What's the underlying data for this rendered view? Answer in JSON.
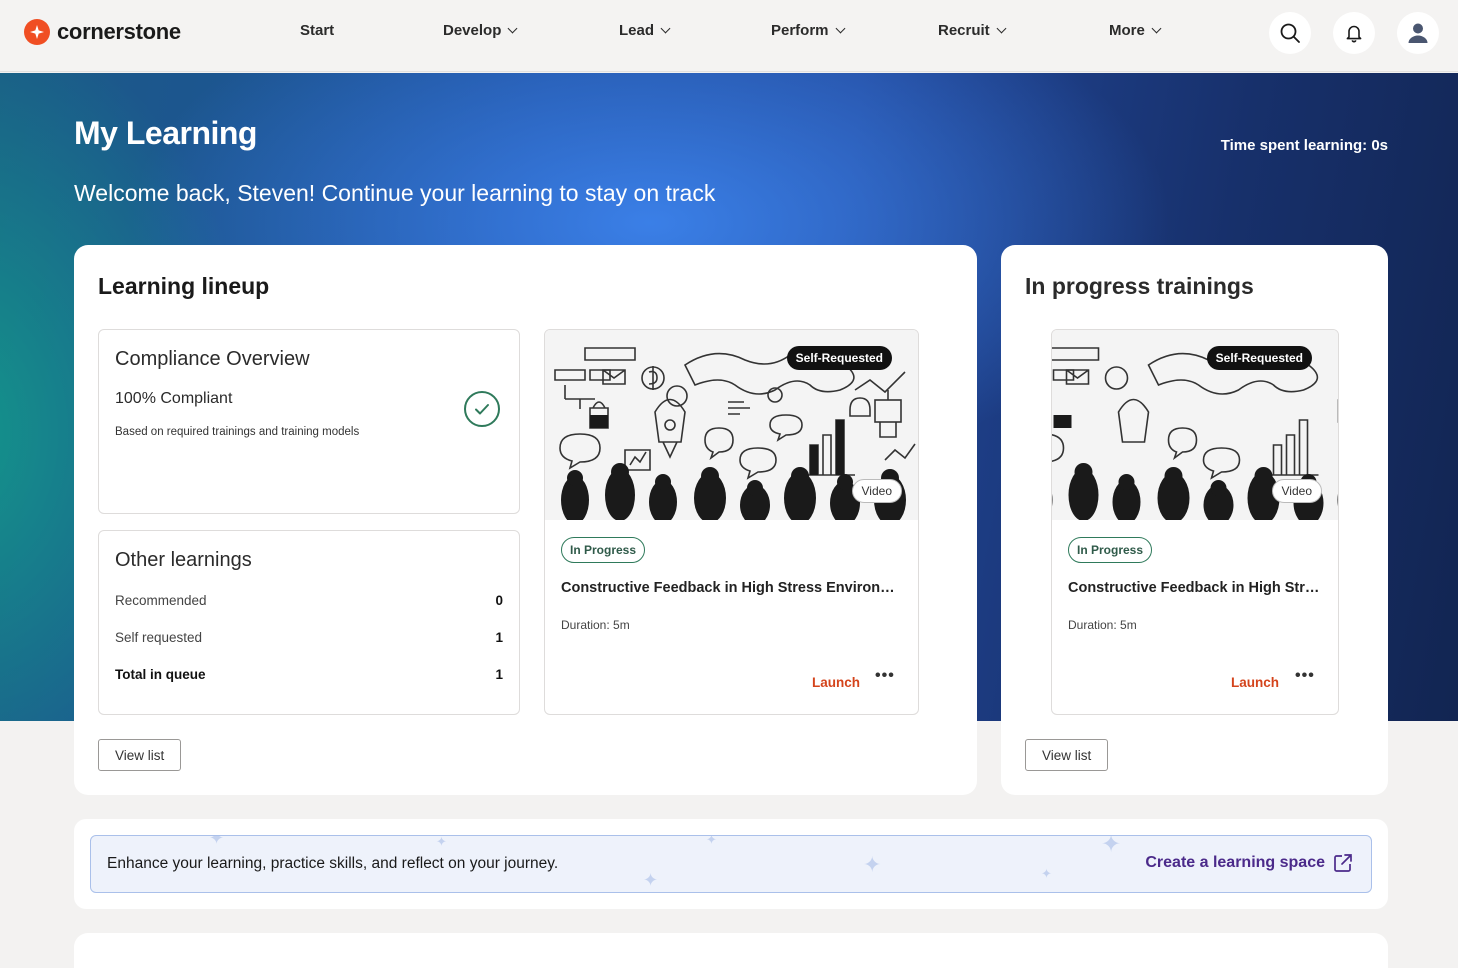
{
  "brand": {
    "name": "cornerstone",
    "accent": "#f04e23"
  },
  "nav": {
    "items": [
      {
        "label": "Start",
        "dropdown": false
      },
      {
        "label": "Develop",
        "dropdown": true
      },
      {
        "label": "Lead",
        "dropdown": true
      },
      {
        "label": "Perform",
        "dropdown": true
      },
      {
        "label": "Recruit",
        "dropdown": true
      },
      {
        "label": "More",
        "dropdown": true
      }
    ],
    "icons": [
      "search-icon",
      "bell-icon",
      "user-icon"
    ]
  },
  "hero": {
    "title": "My Learning",
    "subtitle": "Welcome back, Steven! Continue your learning to stay on track",
    "time_spent_label": "Time spent learning: ",
    "time_spent_value": "0s"
  },
  "lineup": {
    "title": "Learning lineup",
    "compliance": {
      "title": "Compliance Overview",
      "status": "100% Compliant",
      "description": "Based on required trainings and training models"
    },
    "other": {
      "title": "Other learnings",
      "rows": [
        {
          "label": "Recommended",
          "value": "0"
        },
        {
          "label": "Self requested",
          "value": "1"
        },
        {
          "label": "Total in queue",
          "value": "1"
        }
      ]
    },
    "training": {
      "tag": "Self-Requested",
      "type": "Video",
      "status": "In Progress",
      "name": "Constructive Feedback in High Stress Environments",
      "duration": "Duration: 5m",
      "launch": "Launch",
      "more": "•••"
    },
    "view_list": "View list"
  },
  "in_progress": {
    "title": "In progress trainings",
    "training": {
      "tag": "Self-Requested",
      "type": "Video",
      "status": "In Progress",
      "name": "Constructive Feedback in High Stress Environments",
      "duration": "Duration: 5m",
      "launch": "Launch",
      "more": "•••"
    },
    "view_list": "View list"
  },
  "banner": {
    "text": "Enhance your learning, practice skills, and reflect on your journey.",
    "link": "Create a learning space"
  },
  "colors": {
    "launch": "#d4441c",
    "status_border": "#2f7a5b",
    "link_purple": "#4b2a8a"
  }
}
